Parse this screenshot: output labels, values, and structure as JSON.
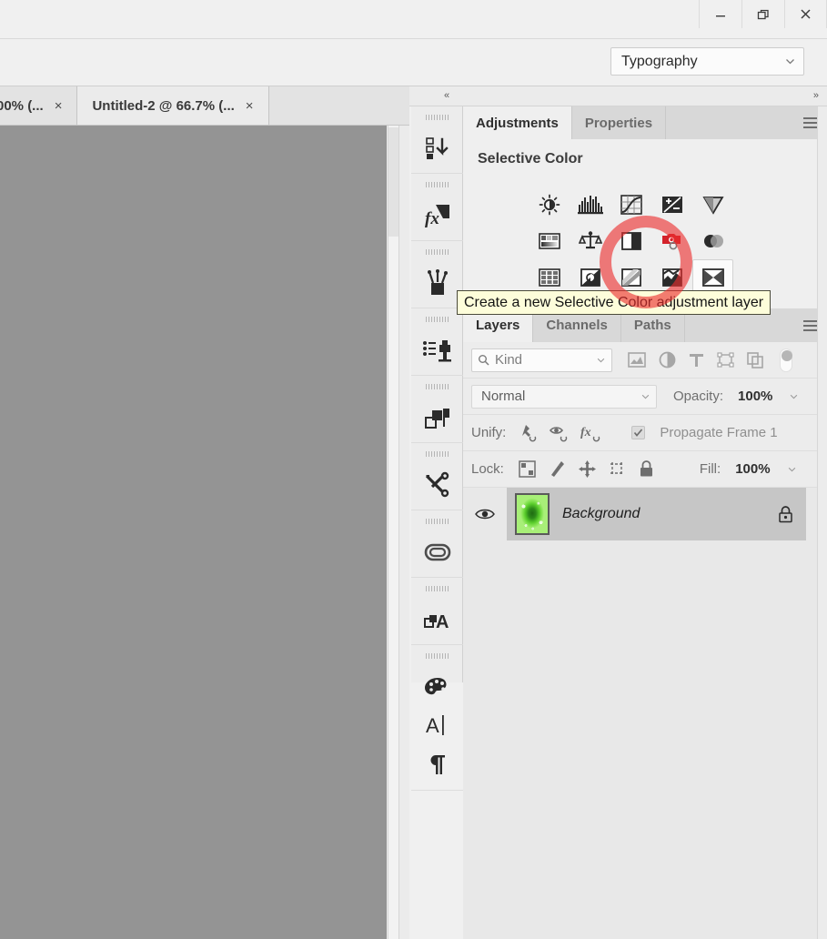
{
  "window": {
    "controls": [
      {
        "name": "minimize",
        "glyph": "minimize-icon"
      },
      {
        "name": "restore",
        "glyph": "restore-icon"
      },
      {
        "name": "close",
        "glyph": "close-icon"
      }
    ]
  },
  "options_bar": {
    "workspace": {
      "label": "Typography",
      "icon": "chevron-down-icon"
    }
  },
  "document_tabs": [
    {
      "label": "00% (...",
      "close": "×",
      "active": false
    },
    {
      "label": "Untitled-2 @ 66.7% (...",
      "close": "×",
      "active": true
    }
  ],
  "dock": {
    "collapse_left": "«",
    "collapse_right": "»",
    "rail_items": [
      {
        "name": "actions-panel-icon",
        "title": "Actions"
      },
      {
        "name": "styles-panel-icon",
        "title": "Styles"
      },
      {
        "name": "brushes-panel-icon",
        "title": "Brushes"
      },
      {
        "name": "clone-source-panel-icon",
        "title": "Clone Source"
      },
      {
        "name": "layer-comps-panel-icon",
        "title": "Layer Comps"
      },
      {
        "name": "tool-presets-panel-icon",
        "title": "Tool Presets"
      },
      {
        "name": "libraries-panel-icon",
        "title": "Libraries"
      },
      {
        "name": "glyphs-panel-icon",
        "title": "Glyphs"
      },
      {
        "name": "color-panel-icon",
        "title": "Color"
      },
      {
        "name": "character-panel-icon",
        "title": "Character"
      },
      {
        "name": "paragraph-panel-icon",
        "title": "Paragraph"
      }
    ]
  },
  "adjustments_panel": {
    "tabs": [
      {
        "label": "Adjustments",
        "active": true
      },
      {
        "label": "Properties",
        "active": false
      }
    ],
    "menu_icon": "panel-menu-icon",
    "title": "Selective Color",
    "buttons": [
      {
        "name": "brightness-contrast",
        "row": 1
      },
      {
        "name": "levels",
        "row": 1
      },
      {
        "name": "curves",
        "row": 1
      },
      {
        "name": "exposure",
        "row": 1
      },
      {
        "name": "vibrance",
        "row": 1
      },
      {
        "name": "hue-saturation",
        "row": 2
      },
      {
        "name": "color-balance",
        "row": 2
      },
      {
        "name": "black-and-white",
        "row": 2
      },
      {
        "name": "photo-filter",
        "row": 2
      },
      {
        "name": "channel-mixer",
        "row": 2
      },
      {
        "name": "color-lookup",
        "row": 2
      },
      {
        "name": "invert",
        "row": 3
      },
      {
        "name": "posterize",
        "row": 3
      },
      {
        "name": "threshold",
        "row": 3
      },
      {
        "name": "selective-color",
        "row": 3,
        "selected": true
      },
      {
        "name": "gradient-map",
        "row": 3
      }
    ]
  },
  "tooltip": {
    "text": "Create a new Selective Color adjustment layer"
  },
  "layers_panel": {
    "tabs": [
      {
        "label": "Layers",
        "active": true
      },
      {
        "label": "Channels",
        "active": false
      },
      {
        "label": "Paths",
        "active": false
      }
    ],
    "menu_icon": "panel-menu-icon",
    "filter": {
      "search_icon": "search-icon",
      "kind_label": "Kind",
      "dropdown_icon": "chevron-down-icon",
      "type_filters": [
        "filter-pixel-icon",
        "filter-adjustment-icon",
        "filter-type-icon",
        "filter-shape-icon",
        "filter-smart-object-icon"
      ],
      "toggle_name": "filter-enable-toggle"
    },
    "blend": {
      "mode": "Normal",
      "mode_dropdown_icon": "chevron-down-icon",
      "opacity_label": "Opacity:",
      "opacity_value": "100%",
      "opacity_dropdown_icon": "chevron-down-icon"
    },
    "unify": {
      "label": "Unify:",
      "icons": [
        "unify-position-icon",
        "unify-visibility-icon",
        "unify-style-icon"
      ],
      "propagate_checked": true,
      "propagate_label": "Propagate Frame 1"
    },
    "lock": {
      "label": "Lock:",
      "icons": [
        "lock-transparent-pixels-icon",
        "lock-image-pixels-icon",
        "lock-position-icon",
        "lock-artboard-nesting-icon",
        "lock-all-icon"
      ],
      "fill_label": "Fill:",
      "fill_value": "100%",
      "fill_dropdown_icon": "chevron-down-icon"
    },
    "layers": [
      {
        "name": "Background",
        "visible": true,
        "locked": true,
        "selected": true,
        "visibility_icon": "eye-icon",
        "lock_icon": "lock-icon",
        "thumbnail": "green-glow-thumbnail"
      }
    ]
  },
  "annotation": {
    "shape": "circle",
    "color": "#eb2d2d",
    "target": "selective-color"
  },
  "colors": {
    "canvas": "#949494",
    "panel_bg": "#e8e8e8",
    "panel_light": "#efefef",
    "tab_inactive": "#d8d8d8",
    "layer_selected": "#c6c6c6",
    "tooltip_bg": "#fdfdda",
    "annotation": "#eb2d2d"
  }
}
